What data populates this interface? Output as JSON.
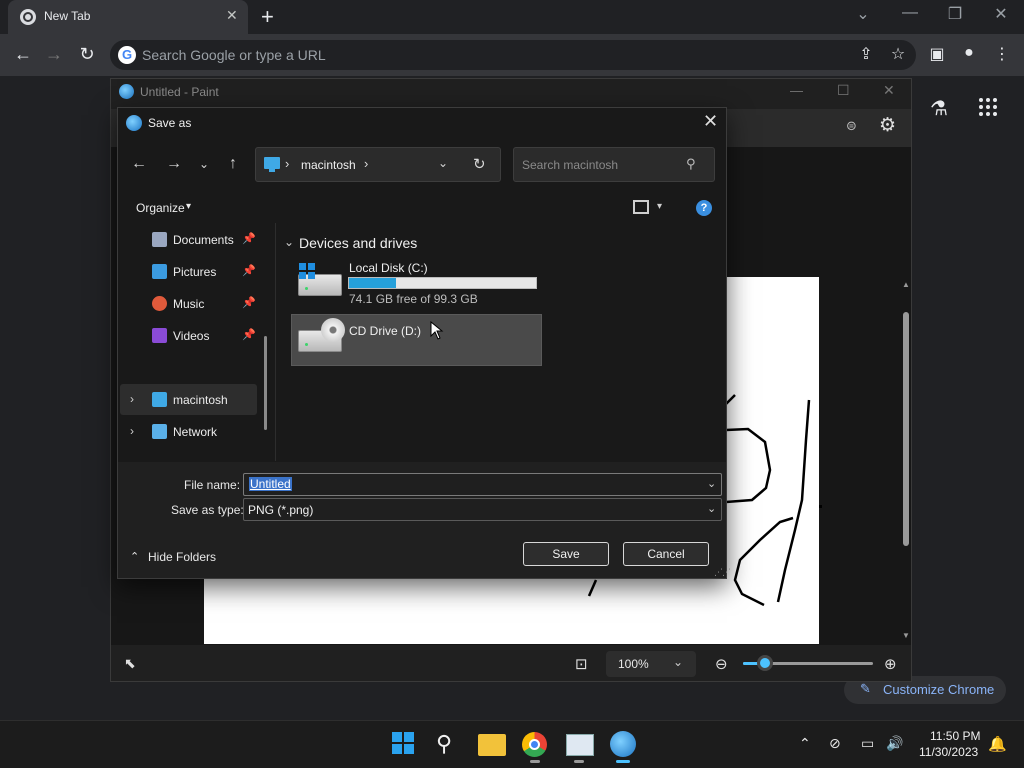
{
  "chrome": {
    "tab_title": "New Tab",
    "tab_close": "✕",
    "new_tab": "+",
    "omnibox_placeholder": "Search Google or type a URL",
    "g_letter": "G",
    "customize_label": "Customize Chrome",
    "win_controls": [
      "⌄",
      "—",
      "❐",
      "✕"
    ],
    "nav": {
      "back": "←",
      "forward": "→",
      "reload": "↻"
    },
    "toolbar_icons": {
      "share": "⇪",
      "bookmark": "☆",
      "sidebar": "▣",
      "profile": "●",
      "menu": "⋮"
    },
    "lab": "⚗",
    "pencil": "✎"
  },
  "paint": {
    "title": "Untitled - Paint",
    "win_controls": [
      "—",
      "☐",
      "✕"
    ],
    "ribbon_icons": {
      "account": "⊜",
      "settings": "⚙"
    },
    "zoom": "100%",
    "zoom_chev": "⌄",
    "status_icons": {
      "pointer": "⬉",
      "fit": "⊡",
      "zoom_out": "⊖",
      "zoom_in": "⊕"
    },
    "zoom_level": 0.17,
    "scroll": {
      "up": "▲",
      "down": "▼"
    }
  },
  "dialog": {
    "title": "Save as",
    "close": "✕",
    "nav_icons": {
      "back": "←",
      "forward": "→",
      "recent": "⌄",
      "up": "↑"
    },
    "address": {
      "location": "macintosh",
      "sep": "›",
      "chevron": "⌄",
      "refresh": "↻"
    },
    "search_placeholder": "Search macintosh",
    "search_icon": "⚲",
    "organize": "Organize",
    "dropdown": "▾",
    "help": "?",
    "quick_access": [
      {
        "label": "Documents",
        "pin": "📌"
      },
      {
        "label": "Pictures",
        "pin": "📌"
      },
      {
        "label": "Music",
        "pin": "📌"
      },
      {
        "label": "Videos",
        "pin": "📌"
      }
    ],
    "tree": [
      {
        "label": "macintosh",
        "expander": "›"
      },
      {
        "label": "Network",
        "expander": "›"
      }
    ],
    "group_chev": "⌄",
    "group_title": "Devices and drives",
    "drives": [
      {
        "label": "Local Disk (C:)",
        "free": "74.1 GB free of 99.3 GB",
        "used_fraction": 0.254
      },
      {
        "label": "CD Drive (D:)"
      }
    ],
    "cursor": "➤",
    "file_name_label": "File name:",
    "file_name_value": "Untitled",
    "save_type_label": "Save as type:",
    "save_type_value": "PNG (*.png)",
    "hide_folders": "Hide Folders",
    "hide_chev": "⌃",
    "save_button": "Save",
    "cancel_button": "Cancel",
    "grip": "⋰⋰"
  },
  "taskbar": {
    "search": "⚲",
    "tray": {
      "overflow": "⌃",
      "network": "▭",
      "volume": "🔊",
      "meet": "⊘"
    },
    "time": "11:50 PM",
    "date": "11/30/2023",
    "bell": "🔔"
  },
  "colors": {
    "accent": "#4cc2ff",
    "selection": "#3b73c9",
    "drive_fill": "#26a0da"
  }
}
